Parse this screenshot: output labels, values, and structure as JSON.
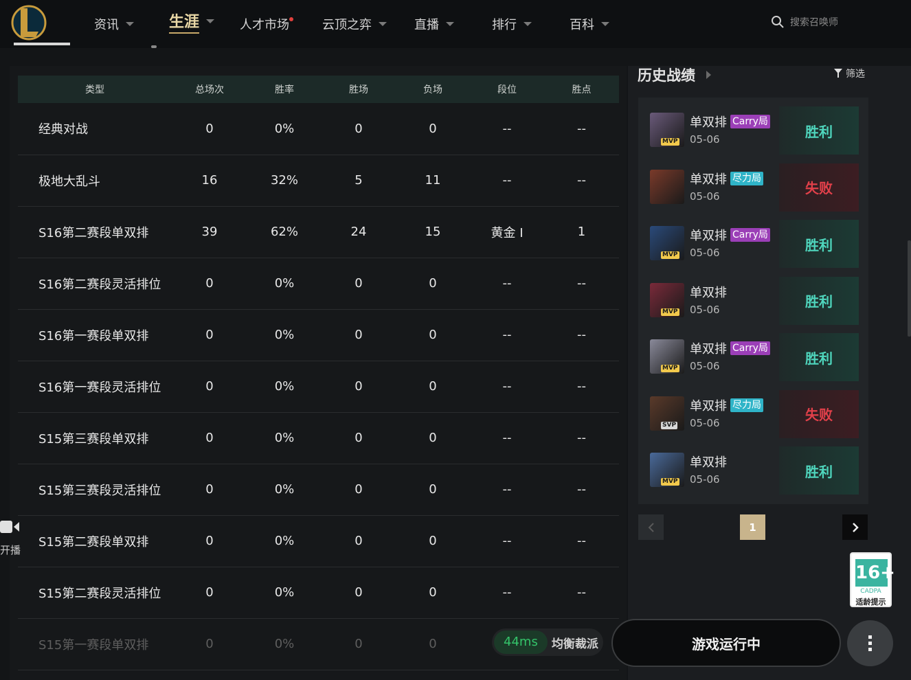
{
  "nav": {
    "items": [
      {
        "label": "资讯",
        "caret": true
      },
      {
        "label": "生涯",
        "caret": true,
        "active": true
      },
      {
        "label": "人才市场",
        "caret": false,
        "dot": true
      },
      {
        "label": "云顶之弈",
        "caret": true
      },
      {
        "label": "直播",
        "caret": true
      },
      {
        "label": "排行",
        "caret": true
      },
      {
        "label": "百科",
        "caret": true
      }
    ],
    "search_placeholder": "搜索召唤师"
  },
  "table": {
    "headers": [
      "类型",
      "总场次",
      "胜率",
      "胜场",
      "负场",
      "段位",
      "胜点"
    ],
    "rows": [
      [
        "经典对战",
        "0",
        "0%",
        "0",
        "0",
        "--",
        "--"
      ],
      [
        "极地大乱斗",
        "16",
        "32%",
        "5",
        "11",
        "--",
        "--"
      ],
      [
        "S16第二赛段单双排",
        "39",
        "62%",
        "24",
        "15",
        "黄金 Ⅰ",
        "1"
      ],
      [
        "S16第二赛段灵活排位",
        "0",
        "0%",
        "0",
        "0",
        "--",
        "--"
      ],
      [
        "S16第一赛段单双排",
        "0",
        "0%",
        "0",
        "0",
        "--",
        "--"
      ],
      [
        "S16第一赛段灵活排位",
        "0",
        "0%",
        "0",
        "0",
        "--",
        "--"
      ],
      [
        "S15第三赛段单双排",
        "0",
        "0%",
        "0",
        "0",
        "--",
        "--"
      ],
      [
        "S15第三赛段灵活排位",
        "0",
        "0%",
        "0",
        "0",
        "--",
        "--"
      ],
      [
        "S15第二赛段单双排",
        "0",
        "0%",
        "0",
        "0",
        "--",
        "--"
      ],
      [
        "S15第二赛段灵活排位",
        "0",
        "0%",
        "0",
        "0",
        "--",
        "--"
      ],
      [
        "S15第一赛段单双排",
        "0",
        "0%",
        "0",
        "0",
        "",
        ""
      ]
    ]
  },
  "side": {
    "stream_label": "开播"
  },
  "history": {
    "title": "历史战绩",
    "filter_label": "筛选",
    "matches": [
      {
        "mode": "单双排",
        "tag": "Carry局",
        "tag_type": "carry",
        "date": "05-06",
        "result": "胜利",
        "win": true,
        "badge": "MVP",
        "color": "#6a5a7a"
      },
      {
        "mode": "单双排",
        "tag": "尽力局",
        "tag_type": "effort",
        "date": "05-06",
        "result": "失败",
        "win": false,
        "badge": "",
        "color": "#7a3a2a"
      },
      {
        "mode": "单双排",
        "tag": "Carry局",
        "tag_type": "carry",
        "date": "05-06",
        "result": "胜利",
        "win": true,
        "badge": "MVP",
        "color": "#2a4a7a"
      },
      {
        "mode": "单双排",
        "tag": "",
        "tag_type": "",
        "date": "05-06",
        "result": "胜利",
        "win": true,
        "badge": "MVP",
        "color": "#7a2a3a"
      },
      {
        "mode": "单双排",
        "tag": "Carry局",
        "tag_type": "carry",
        "date": "05-06",
        "result": "胜利",
        "win": true,
        "badge": "MVP",
        "color": "#8a8a9a"
      },
      {
        "mode": "单双排",
        "tag": "尽力局",
        "tag_type": "effort",
        "date": "05-06",
        "result": "失败",
        "win": false,
        "badge": "SVP",
        "color": "#5a3a2a"
      },
      {
        "mode": "单双排",
        "tag": "",
        "tag_type": "",
        "date": "05-06",
        "result": "胜利",
        "win": true,
        "badge": "MVP",
        "color": "#4a6a9a"
      }
    ],
    "page": "1"
  },
  "age_rating": {
    "number": "16+",
    "org": "CADPA",
    "tip": "适龄提示"
  },
  "status": {
    "ping": "44ms",
    "region": "均衡裁派"
  },
  "game_button": "游戏运行中"
}
